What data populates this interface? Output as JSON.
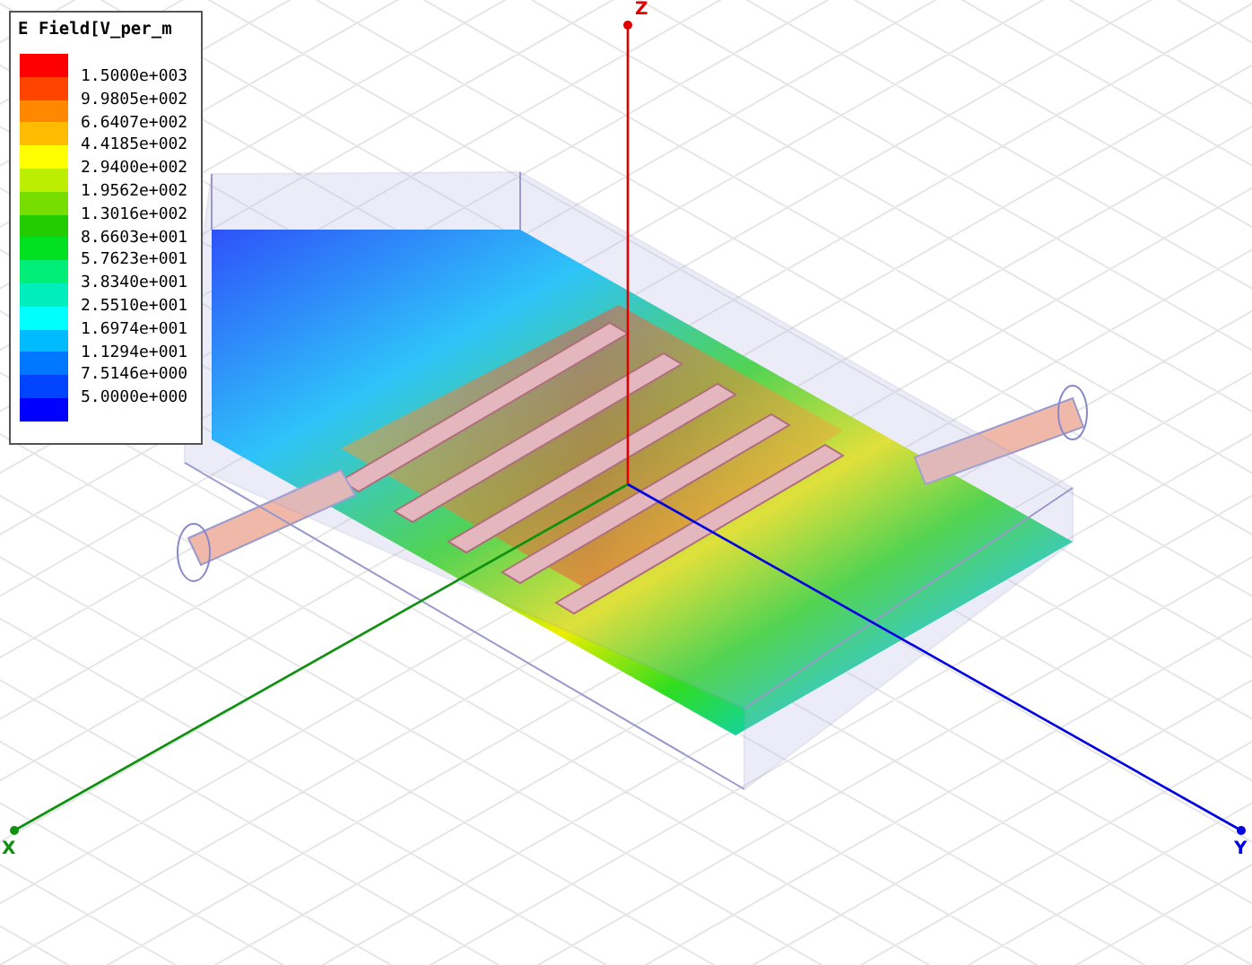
{
  "legend": {
    "title": "E Field[V_per_m",
    "bands": [
      {
        "color": "#ff0000"
      },
      {
        "color": "#ff4400"
      },
      {
        "color": "#ff8800"
      },
      {
        "color": "#ffbb00"
      },
      {
        "color": "#ffff00"
      },
      {
        "color": "#bbee00"
      },
      {
        "color": "#77dd00"
      },
      {
        "color": "#22cc00"
      },
      {
        "color": "#00e020"
      },
      {
        "color": "#00ee77"
      },
      {
        "color": "#00eebb"
      },
      {
        "color": "#00ffff"
      },
      {
        "color": "#00bbff"
      },
      {
        "color": "#0077ff"
      },
      {
        "color": "#0044ff"
      },
      {
        "color": "#0000ff"
      }
    ],
    "labels": [
      "1.5000e+003",
      "9.9805e+002",
      "6.6407e+002",
      "4.4185e+002",
      "2.9400e+002",
      "1.9562e+002",
      "1.3016e+002",
      "8.6603e+001",
      "5.7623e+001",
      "3.8340e+001",
      "2.5510e+001",
      "1.6974e+001",
      "1.1294e+001",
      "7.5146e+000",
      "5.0000e+000"
    ]
  },
  "axes": [
    {
      "kind": "z",
      "label": "Z",
      "color": "#e00000"
    },
    {
      "kind": "x",
      "label": "X",
      "color": "#109010"
    },
    {
      "kind": "y",
      "label": "Y",
      "color": "#0000e0"
    }
  ]
}
